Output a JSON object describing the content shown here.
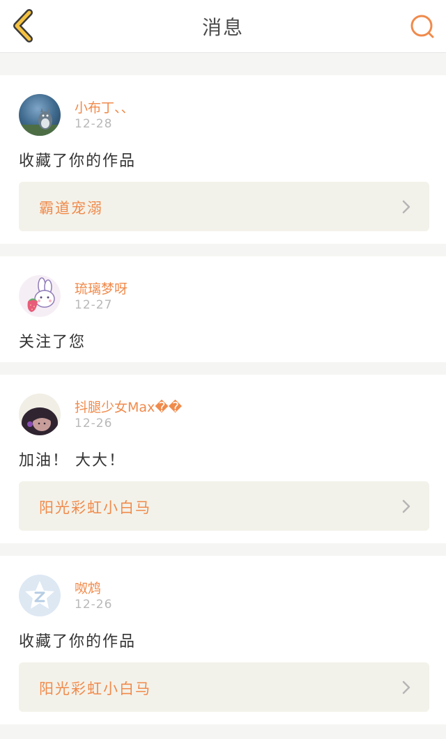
{
  "header": {
    "title": "消息",
    "back_icon": "chevron-left-icon",
    "search_icon": "search-icon",
    "accent_color": "#f5c242",
    "search_color": "#f08a4b"
  },
  "messages": [
    {
      "user": "小布丁、、",
      "date": "12-28",
      "text": "收藏了你的作品",
      "work": "霸道宠溺",
      "avatar": "totoro-avatar"
    },
    {
      "user": "琉璃梦呀",
      "date": "12-27",
      "text": "关注了您",
      "work": null,
      "avatar": "bunny-strawberry-avatar"
    },
    {
      "user": "抖腿少女Max��",
      "date": "12-26",
      "text": "加油！ 大大！",
      "work": "阳光彩虹小白马",
      "avatar": "girl-photo-avatar"
    },
    {
      "user": "呶鸩",
      "date": "12-26",
      "text": "收藏了你的作品",
      "work": "阳光彩虹小白马",
      "avatar": "default-z-avatar"
    }
  ],
  "colors": {
    "username": "#f08a4b",
    "date": "#b8b8b8",
    "work_card_bg": "#f3f2ea",
    "page_bg": "#f5f5f3"
  }
}
